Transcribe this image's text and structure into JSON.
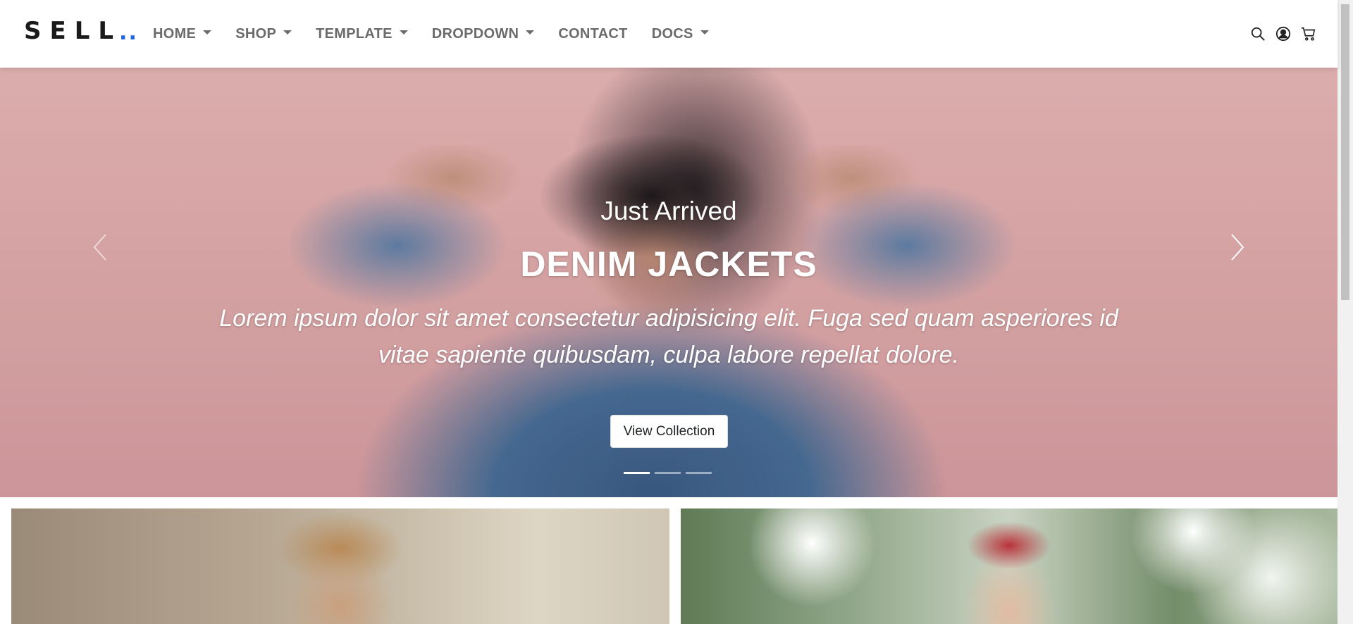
{
  "brand": {
    "name": "SELL",
    "dots": ".."
  },
  "nav": {
    "items": [
      {
        "label": "HOME",
        "dropdown": true
      },
      {
        "label": "SHOP",
        "dropdown": true
      },
      {
        "label": "TEMPLATE",
        "dropdown": true
      },
      {
        "label": "DROPDOWN",
        "dropdown": true
      },
      {
        "label": "CONTACT",
        "dropdown": false
      },
      {
        "label": "DOCS",
        "dropdown": true
      }
    ],
    "icons": [
      "search-icon",
      "user-icon",
      "cart-icon"
    ]
  },
  "hero": {
    "subtitle": "Just Arrived",
    "title": "DENIM JACKETS",
    "text": "Lorem ipsum dolor sit amet consectetur adipisicing elit. Fuga sed quam asperiores id vitae sapiente quibusdam, culpa labore repellat dolore.",
    "button_label": "View Collection",
    "slides_count": 3,
    "active_slide": 1
  },
  "colors": {
    "accent": "#1e66e6",
    "nav_text": "#6b6b6b",
    "hero_bg": "#e3adae"
  }
}
